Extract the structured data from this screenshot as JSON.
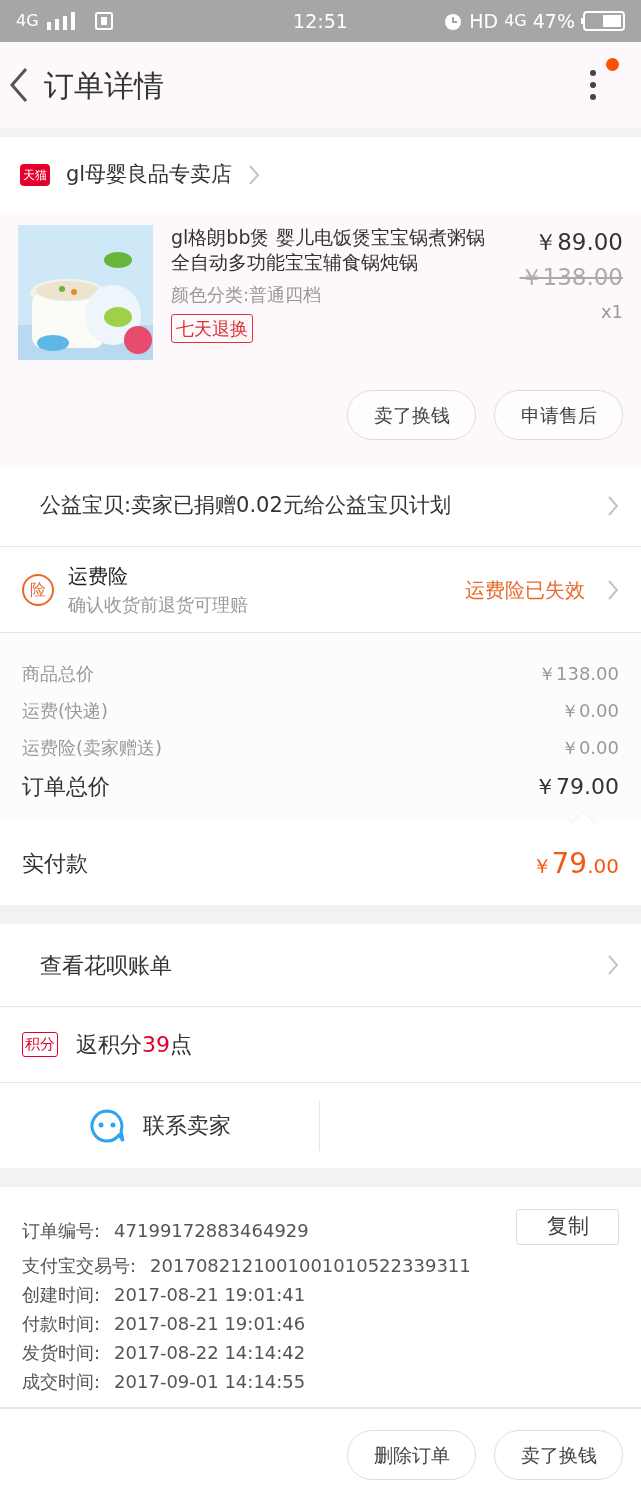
{
  "status_bar": {
    "network": "4G",
    "time": "12:51",
    "hd": "HD",
    "network_right": "4G",
    "battery": "47%"
  },
  "header": {
    "title": "订单详情",
    "has_badge": true
  },
  "store": {
    "badge": "天猫",
    "name": "gl母婴良品专卖店"
  },
  "product": {
    "kind": "picture",
    "title": "gl格朗bb煲 婴儿电饭煲宝宝锅煮粥锅全自动多功能宝宝辅食锅炖锅",
    "variant": "颜色分类:普通四档",
    "tag": "七天退换",
    "price": "￥89.00",
    "original_price": "￥138.00",
    "quantity": "x1"
  },
  "item_actions": [
    "卖了换钱",
    "申请售后"
  ],
  "charity": {
    "text": "公益宝贝:卖家已捐赠0.02元给公益宝贝计划"
  },
  "insurance": {
    "icon": "险",
    "title": "运费险",
    "subtitle": "确认收货前退货可理赔",
    "status": "运费险已失效"
  },
  "costs": [
    {
      "kind": "minor",
      "label": "商品总价",
      "value": "￥138.00"
    },
    {
      "kind": "minor",
      "label": "运费(快递)",
      "value": "￥0.00"
    },
    {
      "kind": "minor",
      "label": "运费险(卖家赠送)",
      "value": "￥0.00"
    },
    {
      "kind": "total",
      "label": "订单总价",
      "value": "￥79.00"
    }
  ],
  "paid": {
    "label": "实付款",
    "currency": "￥",
    "amount": "79",
    "decimals": ".00"
  },
  "huabei": {
    "text": "查看花呗账单"
  },
  "points": {
    "badge": "积分",
    "prefix": "返积分",
    "count": "39",
    "suffix": "点"
  },
  "contact": {
    "text": "联系卖家"
  },
  "order_info": [
    {
      "label": "订单编号:",
      "value": "47199172883464929"
    },
    {
      "label": "支付宝交易号:",
      "value": "2017082121001001010522339311"
    },
    {
      "label": "创建时间:",
      "value": "2017-08-21 19:01:41"
    },
    {
      "label": "付款时间:",
      "value": "2017-08-21 19:01:46"
    },
    {
      "label": "发货时间:",
      "value": "2017-08-22 14:14:42"
    },
    {
      "label": "成交时间:",
      "value": "2017-09-01 14:14:55"
    }
  ],
  "copy_button": "复制",
  "bottom_actions": [
    "删除订单",
    "卖了换钱"
  ]
}
